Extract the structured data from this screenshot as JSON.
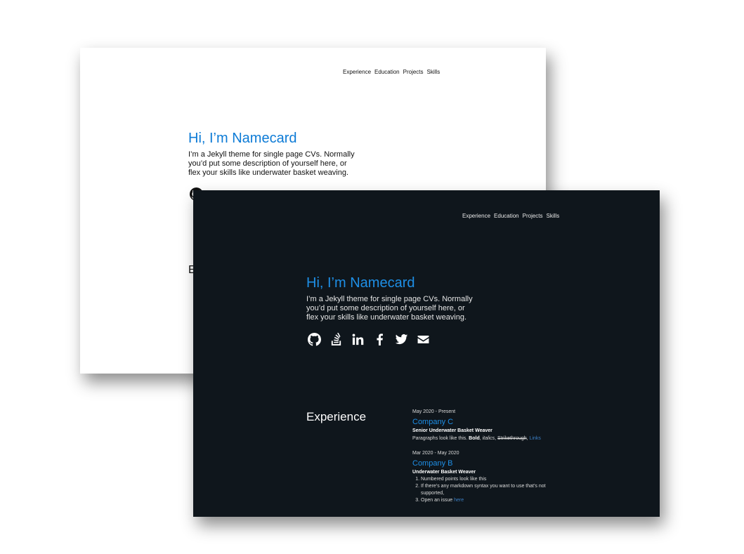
{
  "nav": [
    "Experience",
    "Education",
    "Projects",
    "Skills"
  ],
  "hero": {
    "title": "Hi, I’m Namecard",
    "description": "I’m a Jekyll theme for single page CVs. Normally you’d put some description of yourself here, or flex your skills like underwater basket weaving."
  },
  "socials": [
    "github-icon",
    "stackoverflow-icon",
    "linkedin-icon",
    "facebook-icon",
    "twitter-icon",
    "email-icon"
  ],
  "light_section_partial": "E",
  "experience": {
    "heading": "Experience",
    "jobs": [
      {
        "date": "May 2020 - Present",
        "company": "Company C",
        "role": "Senior Underwater Basket Weaver",
        "text_prefix": "Paragraphs look like this.",
        "bold": "Bold",
        "italics": "italics",
        "strike": "Strikethrough",
        "link": "Links"
      },
      {
        "date": "Mar 2020 - May 2020",
        "company": "Company B",
        "role": "Underwater Basket Weaver",
        "points": [
          "Numbered points look like this",
          "If there’s any markdown syntax you want to use that’s not supported,",
          "Open an issue"
        ],
        "point_link": "here"
      }
    ]
  },
  "colors": {
    "accent_light": "#0d7bd6",
    "accent_dark": "#1e8fe6",
    "dark_bg": "#0f161c"
  }
}
